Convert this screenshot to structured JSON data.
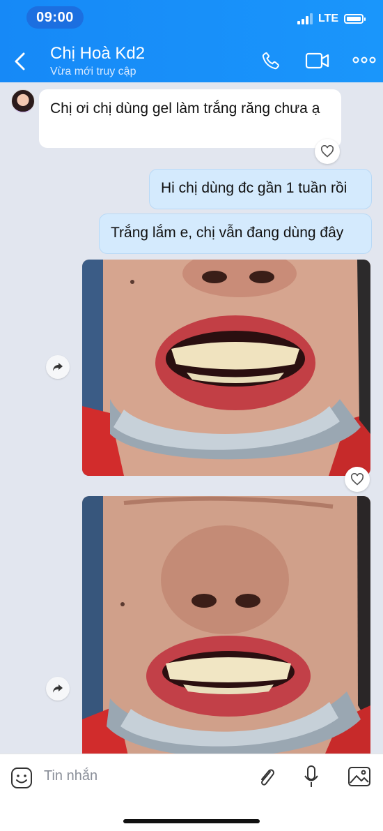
{
  "status_bar": {
    "time": "09:00",
    "network": "LTE",
    "battery_level": 0.9
  },
  "header": {
    "contact_name": "Chị Hoà Kd2",
    "status": "Vừa mới truy cập",
    "icons": [
      "back-icon",
      "phone-icon",
      "video-call-icon",
      "more-icon"
    ]
  },
  "messages": [
    {
      "direction": "incoming",
      "type": "text",
      "text": "Chị ơi chị dùng gel làm trắng răng chưa ạ"
    },
    {
      "direction": "outgoing",
      "type": "text",
      "text": "Hi chị dùng đc gần 1 tuần rồi"
    },
    {
      "direction": "outgoing",
      "type": "text",
      "text": "Trắng lắm e, chị vẫn đang dùng đây"
    },
    {
      "direction": "outgoing",
      "type": "image",
      "description": "smile photo 1"
    },
    {
      "direction": "outgoing",
      "type": "image",
      "description": "smile photo 2"
    }
  ],
  "input": {
    "placeholder": "Tin nhắn"
  },
  "colors": {
    "header": "#1a8ff8",
    "chat_bg": "#e2e6ef",
    "outgoing_bubble": "#d4eafd"
  }
}
